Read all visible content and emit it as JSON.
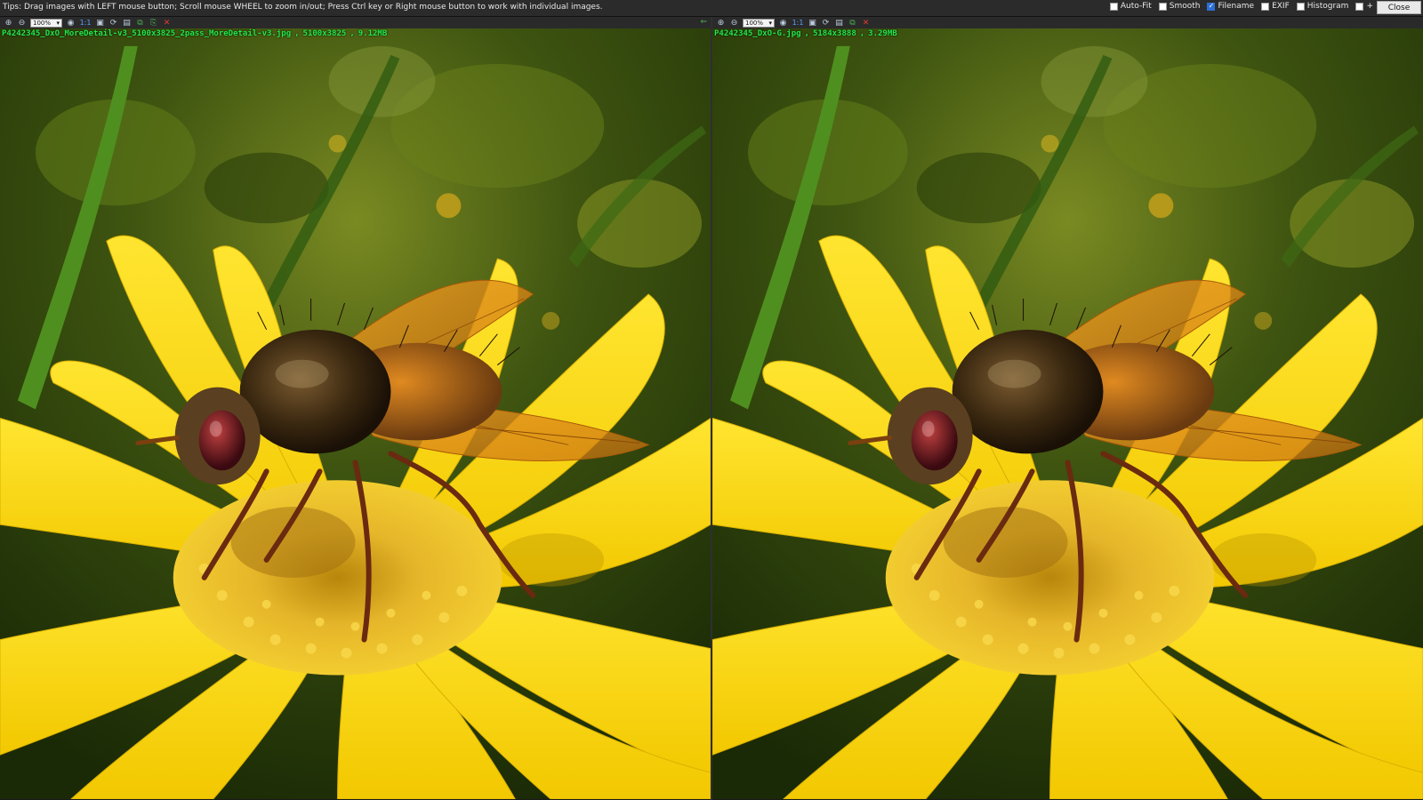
{
  "topbar": {
    "tips": "Tips: Drag images with LEFT mouse button; Scroll mouse WHEEL to zoom in/out; Press Ctrl key or Right mouse button to work with individual images.",
    "options": [
      {
        "label": "Auto-Fit",
        "checked": false
      },
      {
        "label": "Smooth",
        "checked": false
      },
      {
        "label": "Filename",
        "checked": true
      },
      {
        "label": "EXIF",
        "checked": false
      },
      {
        "label": "Histogram",
        "checked": false
      },
      {
        "label": "+",
        "checked": false
      }
    ],
    "close_label": "Close"
  },
  "left": {
    "zoom": "100%",
    "one_to_one": "1:1",
    "filename": "P4242345_DxO_MoreDetail-v3_5100x3825_2pass_MoreDetail-v3.jpg",
    "dims": "5100x3825",
    "size": "9.12MB"
  },
  "right": {
    "zoom": "100%",
    "one_to_one": "1:1",
    "filename": "P4242345_DxO-G.jpg",
    "dims": "5184x3888",
    "size": "3.29MB"
  },
  "colors": {
    "filename_text": "#22e84a",
    "petal": "#f7d90a",
    "background_green": "#3f5a12"
  },
  "icons": [
    "zoom-in-icon",
    "zoom-out-icon",
    "fit-icon",
    "rotate-icon",
    "save-icon",
    "copy-icon",
    "paste-icon",
    "close-icon",
    "sync-arrow-icon"
  ]
}
